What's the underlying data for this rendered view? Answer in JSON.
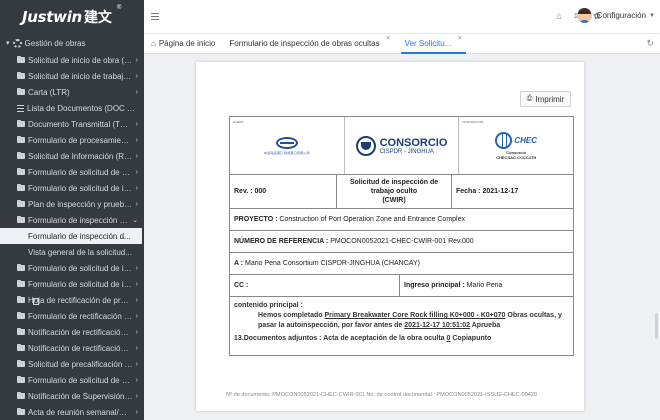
{
  "brand": {
    "name": "Justwin",
    "cn": "建文",
    "reg": "®"
  },
  "sidebar": {
    "root": "Gestión de obras",
    "items": [
      {
        "label": "Solicitud de inicio de obra (WR)",
        "icon": "folder-icon",
        "arrow": "›"
      },
      {
        "label": "Solicitud de inicio de trabajos ...",
        "icon": "folder-icon",
        "arrow": "›"
      },
      {
        "label": "Carta (LTR)",
        "icon": "folder-icon",
        "arrow": "›"
      },
      {
        "label": "Lista de Documentos (DOC LIST)",
        "icon": "list-icon",
        "arrow": ""
      },
      {
        "label": "Documento Transmittal (TRAN)",
        "icon": "folder-icon",
        "arrow": "›"
      },
      {
        "label": "Formulario de procesamiento...",
        "icon": "folder-icon",
        "arrow": "›"
      },
      {
        "label": "Solicitud de Información (RFI)",
        "icon": "folder-icon",
        "arrow": "›"
      },
      {
        "label": "Formulario de solicitud de ma...",
        "icon": "folder-icon",
        "arrow": "›"
      },
      {
        "label": "Formulario de solicitud de in...",
        "icon": "folder-icon",
        "arrow": "›"
      },
      {
        "label": "Plan de inspección y prueba ...",
        "icon": "folder-icon",
        "arrow": "›"
      },
      {
        "label": "Formulario de inspección de ...",
        "icon": "folder-icon",
        "arrow": "⌄"
      }
    ],
    "sub_items": [
      {
        "label": "Formulario de inspección d...",
        "active": true
      },
      {
        "label": "Vista general de la solicitud...",
        "active": false
      }
    ],
    "items_after": [
      {
        "label": "Formulario de solicitud de ins...",
        "icon": "folder-icon",
        "arrow": "›"
      },
      {
        "label": "Formulario de solicitud de ins...",
        "icon": "folder-icon",
        "arrow": "›"
      },
      {
        "label": "Hoja de rectificación de probl...",
        "icon": "folder-icon",
        "arrow": "›"
      },
      {
        "label": "Formulario de rectificación d...",
        "icon": "folder-icon",
        "arrow": "›"
      },
      {
        "label": "Notificación de rectificación ...",
        "icon": "folder-icon",
        "arrow": "›"
      },
      {
        "label": "Notificación de rectificación ...",
        "icon": "folder-icon",
        "arrow": "›"
      },
      {
        "label": "Solicitud de precalificación d...",
        "icon": "folder-icon",
        "arrow": "›"
      },
      {
        "label": "Formulario de solicitud de ca...",
        "icon": "folder-icon",
        "arrow": "›"
      },
      {
        "label": "Notificación de Supervisión (...",
        "icon": "folder-icon",
        "arrow": "›"
      },
      {
        "label": "Acta de reunión semanal/me...",
        "icon": "folder-icon",
        "arrow": "›"
      }
    ]
  },
  "header": {
    "user_label": "Configuración"
  },
  "tabs": [
    {
      "label": "Página de inicio",
      "active": false,
      "closable": false
    },
    {
      "label": "Formulario de inspección de obras ocultas",
      "active": false,
      "closable": true
    },
    {
      "label": "Ver Solicitu...",
      "active": true,
      "closable": true
    }
  ],
  "toolbar": {
    "print_label": "Imprimir"
  },
  "form": {
    "logos": {
      "client_tag": "CLIENT",
      "cosco_text": "中远海运港口   钱凯港口有限公司",
      "consorcio_big": "CONSORCIO",
      "consorcio_small": "CISPDR - JINGHUA",
      "contractor_tag": "CONTRACTOR",
      "chec_text": "CHEC",
      "chec_sub": "Consorcio",
      "chec_sub2": "CHECSAC-CCCC4TH"
    },
    "rev": "Rev. :  000",
    "title_line1": "Solicitud de inspección de",
    "title_line2": "trabajo oculto",
    "title_line3": "(CWIR)",
    "fecha": "Fecha : 2021-12-17",
    "proyecto_label": "PROYECTO :",
    "proyecto_value": "Construction of Port Operation Zone and Entrance Complex",
    "referencia_label": "NÚMERO DE REFERENCIA :",
    "referencia_value": "PMOCON0052021-CHEC-CWIR-001 Rev.000",
    "a_label": "A :",
    "a_value": "Mario Pena Consortium CISPDR-JINGHUA (CHANCAY)",
    "cc_label": "CC :",
    "cc_value": "",
    "ingreso_label": "Ingreso principal :",
    "ingreso_value": "Mario Pena",
    "contenido_label": "contenido principal :",
    "body_1": "Hemos completado ",
    "body_work": "Primary Breakwater Core Rock filling K0+000 - K0+070",
    "body_2": " Obras ocultas, y pasar la autoinspección, por favor antes de ",
    "body_date": "2021-12-17 10:51:02",
    "body_3": " Aprueba",
    "attachments": "13.Documentos adjuntos : Acta de aceptación de la obra oculta ",
    "attachments_count": "0",
    "attachments_end": " Copiapunto",
    "footer_note": "Nº de documento: PMOCON0052021-CHEC-CWIR-001 No. de control documental : PMOCON0052021-ISSUE-CHEC-00420"
  },
  "colors": {
    "sidebar_bg": "#353a40",
    "accent": "#2a7ad6",
    "content_bg": "#eef0f3"
  }
}
